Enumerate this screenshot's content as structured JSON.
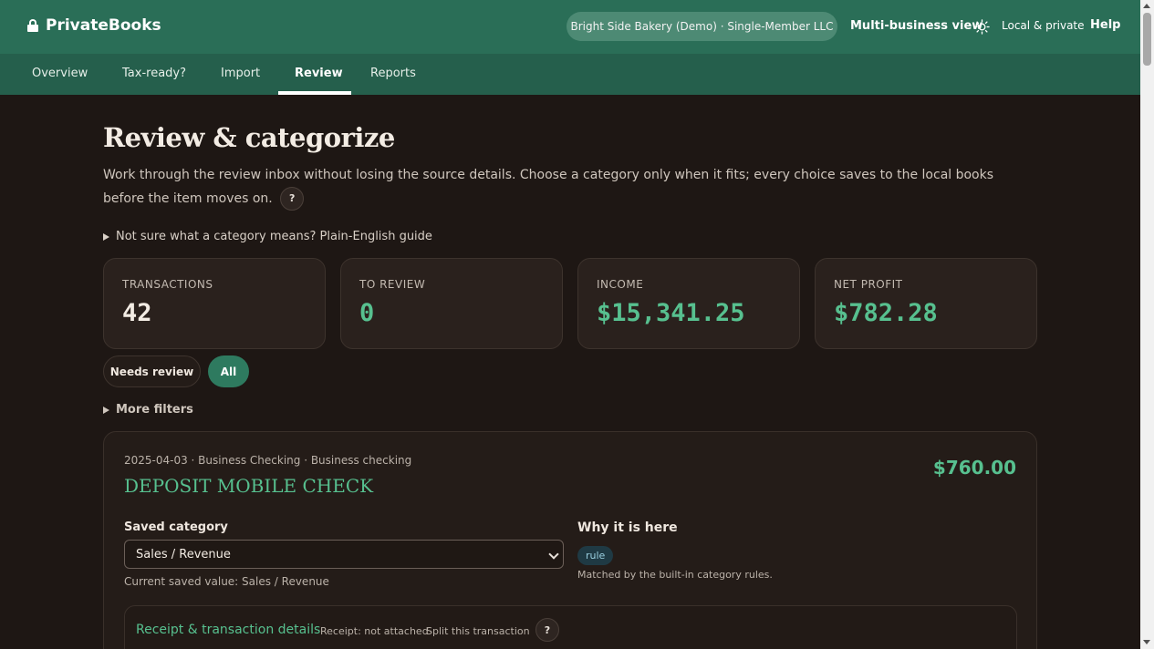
{
  "app": {
    "name": "PrivateBooks"
  },
  "header": {
    "business": "Bright Side Bakery (Demo) · Single-Member LLC",
    "multi_business": "Multi-business view",
    "privacy": "Local & private",
    "help": "Help"
  },
  "tabs": [
    {
      "label": "Overview"
    },
    {
      "label": "Tax-ready?"
    },
    {
      "label": "Import"
    },
    {
      "label": "Review",
      "active": true
    },
    {
      "label": "Reports"
    }
  ],
  "page": {
    "title": "Review & categorize",
    "intro": "Work through the review inbox without losing the source details. Choose a category only when it fits; every choice saves to the local books before the item moves on.",
    "help_glyph": "?",
    "guide": "Not sure what a category means? Plain-English guide"
  },
  "stats": [
    {
      "label": "TRANSACTIONS",
      "value": "42",
      "color": "#f3ece4"
    },
    {
      "label": "TO REVIEW",
      "value": "0",
      "color": "#57c08f"
    },
    {
      "label": "INCOME",
      "value": "$15,341.25",
      "color": "#57c08f"
    },
    {
      "label": "NET PROFIT",
      "value": "$782.28",
      "color": "#57c08f"
    }
  ],
  "filters": {
    "needs_review": "Needs review",
    "all": "All",
    "more": "More filters"
  },
  "transaction": {
    "meta": "2025-04-03 · Business Checking · Business checking",
    "name": "DEPOSIT MOBILE CHECK",
    "amount": "$760.00",
    "saved_category_label": "Saved category",
    "category_value": "Sales / Revenue",
    "current_saved": "Current saved value: Sales / Revenue",
    "why_label": "Why it is here",
    "reason_badge": "rule",
    "reason_text": "Matched by the built-in category rules.",
    "details_title": "Receipt & transaction details",
    "receipt_status": "Receipt: not attached",
    "split_label": "Split this transaction"
  },
  "colors": {
    "header_bg": "#2a6e57",
    "tabs_bg": "#255f4c",
    "page_bg": "#1e1714",
    "accent_green": "#57c08f"
  }
}
